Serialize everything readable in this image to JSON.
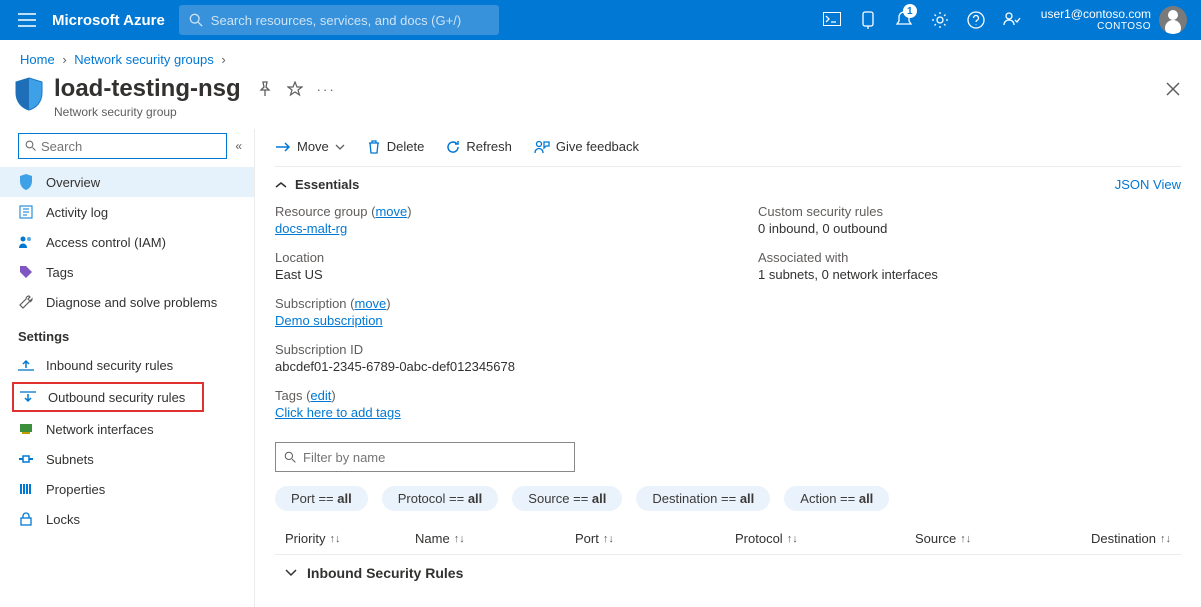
{
  "header": {
    "brand": "Microsoft Azure",
    "search_placeholder": "Search resources, services, and docs (G+/)",
    "notification_count": "1",
    "user_email": "user1@contoso.com",
    "user_tenant": "CONTOSO"
  },
  "breadcrumb": {
    "items": [
      {
        "label": "Home"
      },
      {
        "label": "Network security groups"
      }
    ]
  },
  "resource": {
    "title": "load-testing-nsg",
    "subtype": "Network security group"
  },
  "sidebar": {
    "search_placeholder": "Search",
    "items": [
      {
        "key": "overview",
        "label": "Overview"
      },
      {
        "key": "activity-log",
        "label": "Activity log"
      },
      {
        "key": "access-control",
        "label": "Access control (IAM)"
      },
      {
        "key": "tags",
        "label": "Tags"
      },
      {
        "key": "diagnose",
        "label": "Diagnose and solve problems"
      }
    ],
    "section_settings": "Settings",
    "settings_items": [
      {
        "key": "inbound-rules",
        "label": "Inbound security rules"
      },
      {
        "key": "outbound-rules",
        "label": "Outbound security rules"
      },
      {
        "key": "net-interfaces",
        "label": "Network interfaces"
      },
      {
        "key": "subnets",
        "label": "Subnets"
      },
      {
        "key": "properties",
        "label": "Properties"
      },
      {
        "key": "locks",
        "label": "Locks"
      }
    ]
  },
  "toolbar": {
    "move": "Move",
    "delete": "Delete",
    "refresh": "Refresh",
    "feedback": "Give feedback"
  },
  "essentials": {
    "heading": "Essentials",
    "json_view": "JSON View",
    "left": {
      "resource_group_label": "Resource group",
      "move_link": "move",
      "resource_group": "docs-malt-rg",
      "location_label": "Location",
      "location": "East US",
      "subscription_label": "Subscription",
      "subscription": "Demo subscription",
      "subscription_id_label": "Subscription ID",
      "subscription_id": "abcdef01-2345-6789-0abc-def012345678",
      "tags_label": "Tags",
      "edit_link": "edit",
      "tags_value": "Click here to add tags"
    },
    "right": {
      "custom_rules_label": "Custom security rules",
      "custom_rules": "0 inbound, 0 outbound",
      "associated_label": "Associated with",
      "associated": "1 subnets, 0 network interfaces"
    }
  },
  "rules": {
    "filter_placeholder": "Filter by name",
    "pills": {
      "port": "Port == ",
      "protocol": "Protocol == ",
      "source": "Source == ",
      "destination": "Destination == ",
      "action": "Action == ",
      "all": "all"
    },
    "columns": {
      "priority": "Priority",
      "name": "Name",
      "port": "Port",
      "protocol": "Protocol",
      "source": "Source",
      "destination": "Destination"
    },
    "section_inbound": "Inbound Security Rules"
  }
}
